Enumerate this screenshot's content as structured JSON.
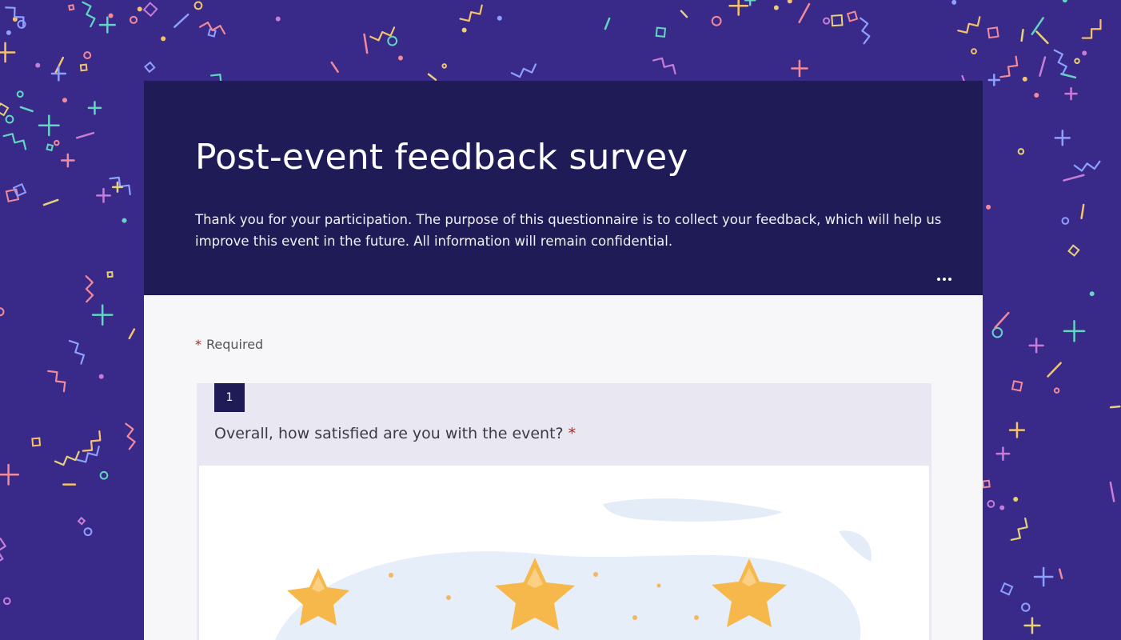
{
  "form": {
    "title": "Post-event feedback survey",
    "description": "Thank you for your participation. The purpose of this questionnaire is to collect your feedback, which will help us improve this event in the future. All information will remain confidential.",
    "more_icon": "more-horizontal-icon",
    "required_marker": "*",
    "required_label": "Required"
  },
  "question": {
    "number": "1",
    "text": "Overall, how satisfied are you with the event?",
    "required_marker": "*",
    "image_icon": "stars-illustration"
  },
  "colors": {
    "background": "#392a89",
    "header": "#1f1b57",
    "required": "#b3261e",
    "star": "#f7b84b",
    "question_bg": "#e9e7f1"
  }
}
